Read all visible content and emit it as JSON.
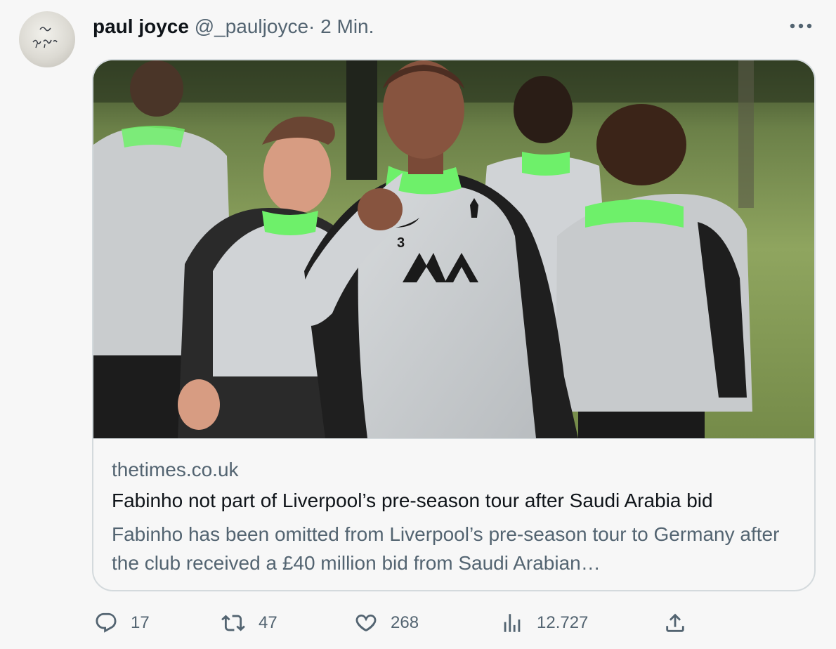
{
  "author": {
    "display_name": "paul joyce",
    "handle": "@_pauljoyce",
    "separator": "·",
    "time": "2 Min."
  },
  "card": {
    "domain": "thetimes.co.uk",
    "title": "Fabinho not part of Liverpool’s pre-season tour after Saudi Arabia bid",
    "description": "Fabinho has been omitted from Liverpool’s pre-season tour to Germany after the club received a £40 million bid from Saudi Arabian…",
    "image_shirt_number": "3"
  },
  "actions": {
    "replies": "17",
    "retweets": "47",
    "likes": "268",
    "views": "12.727"
  },
  "icons": {
    "reply": "speech-bubble-icon",
    "retweet": "retweet-arrows-icon",
    "like": "heart-icon",
    "views": "bar-chart-icon",
    "share": "share-upload-icon",
    "more": "three-dots-icon"
  },
  "colors": {
    "background": "#f7f7f7",
    "text_primary": "#0f1419",
    "text_secondary": "#536471",
    "border": "#d4dadd",
    "kit_green": "#6ef06a"
  }
}
